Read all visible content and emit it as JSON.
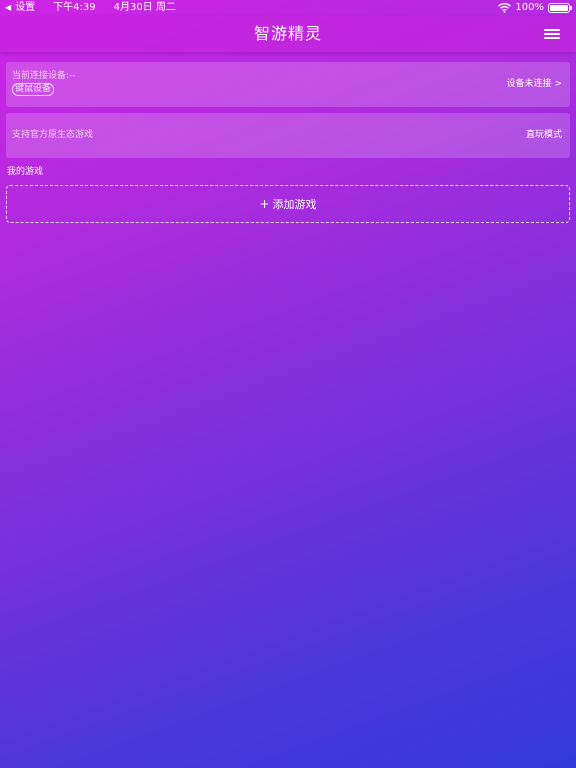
{
  "status_bar": {
    "back_glyph": "◀",
    "back_label": "设置",
    "time": "下午4:39",
    "date": "4月30日 周二",
    "battery": "100%",
    "icons": [
      "wifi-icon",
      "battery-icon"
    ]
  },
  "nav": {
    "title": "智游精灵",
    "menu_icon": "hamburger-menu-icon"
  },
  "device_card": {
    "label": "当前连接设备:--",
    "badge": "键鼠设备",
    "status": "设备未连接",
    "chevron": ">"
  },
  "mode_card": {
    "description": "支持官方原生态游戏",
    "mode": "直玩模式"
  },
  "games": {
    "section_title": "我的游戏",
    "add_plus": "+",
    "add_label": "添加游戏"
  },
  "colors": {
    "gradient_start": "#cf24e6",
    "gradient_end": "#333ad8",
    "text": "#ffffff"
  }
}
